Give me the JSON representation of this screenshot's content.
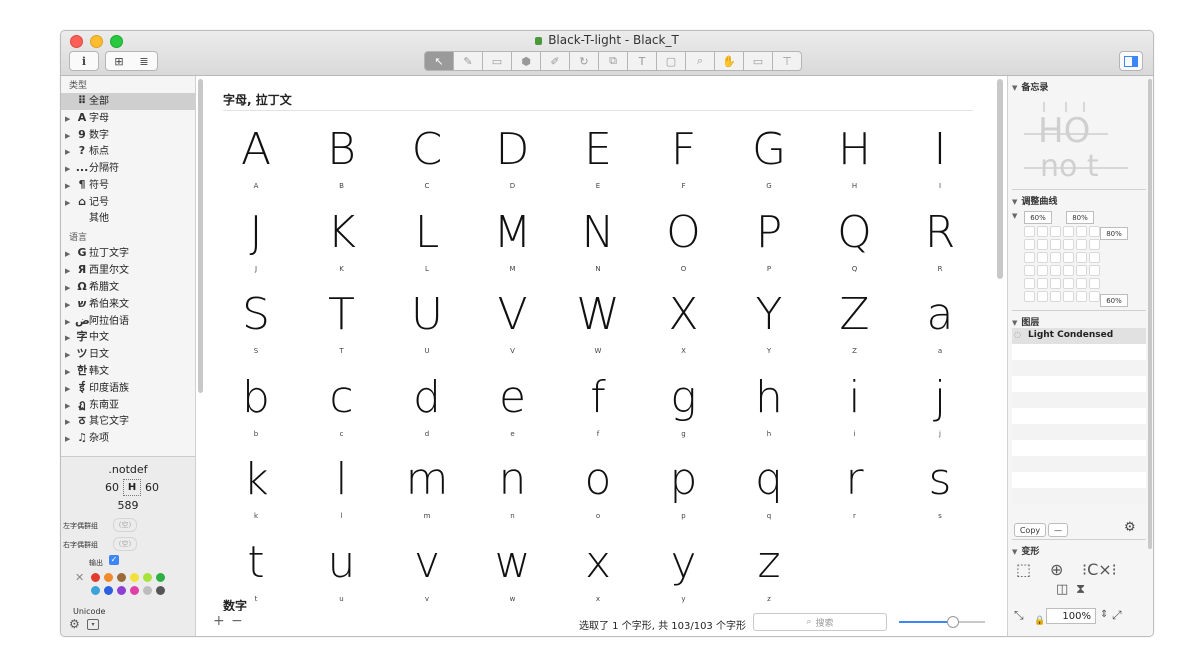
{
  "window": {
    "title": "Black-T-light - Black_T"
  },
  "toolbar": {
    "info_label": "i",
    "grid_view_label": "⊞",
    "list_view_label": "≣",
    "tools": [
      "↖",
      "✎",
      "▭",
      "⬢",
      "✐",
      "↻",
      "⧉",
      "T",
      "▢",
      "⌕",
      "✋",
      "▭",
      "⊤"
    ]
  },
  "sidebar": {
    "category_header": "类型",
    "categories": [
      {
        "glyph": "⠿",
        "label": "全部",
        "selected": true
      },
      {
        "glyph": "A",
        "label": "字母"
      },
      {
        "glyph": "9",
        "label": "数字"
      },
      {
        "glyph": "?",
        "label": "标点"
      },
      {
        "glyph": "...",
        "label": "分隔符"
      },
      {
        "glyph": "¶",
        "label": "符号"
      },
      {
        "glyph": "⌂",
        "label": "记号"
      },
      {
        "glyph": "",
        "label": "其他"
      }
    ],
    "language_header": "语言",
    "languages": [
      {
        "glyph": "G",
        "label": "拉丁文字"
      },
      {
        "glyph": "Я",
        "label": "西里尔文"
      },
      {
        "glyph": "Ω",
        "label": "希腊文"
      },
      {
        "glyph": "ש",
        "label": "希伯来文"
      },
      {
        "glyph": "ض",
        "label": "阿拉伯语"
      },
      {
        "glyph": "字",
        "label": "中文"
      },
      {
        "glyph": "ツ",
        "label": "日文"
      },
      {
        "glyph": "한",
        "label": "韩文"
      },
      {
        "glyph": "ई",
        "label": "印度语族"
      },
      {
        "glyph": "ฏ",
        "label": "东南亚"
      },
      {
        "glyph": "ठ",
        "label": "其它文字"
      },
      {
        "glyph": "♫",
        "label": "杂项"
      }
    ]
  },
  "info": {
    "glyph_name": ".notdef",
    "lsb": "60",
    "rsb": "60",
    "width": "589",
    "left_group_label": "左字偶群组",
    "right_group_label": "右字偶群组",
    "empty_placeholder": "(空)",
    "export_label": "输出",
    "unicode_label": "Unicode",
    "swatches": [
      "#e23b2f",
      "#f08a2c",
      "#9b6a3a",
      "#f3e03b",
      "#a7e33b",
      "#2fae43",
      "#3aa3d9",
      "#2d5fe0",
      "#8e3fd6",
      "#e03fa8",
      "#bdbdbd",
      "#555555"
    ]
  },
  "main": {
    "group_title": "字母, 拉丁文",
    "next_group_title": "数字",
    "glyphs": [
      "A",
      "B",
      "C",
      "D",
      "E",
      "F",
      "G",
      "H",
      "I",
      "J",
      "K",
      "L",
      "M",
      "N",
      "O",
      "P",
      "Q",
      "R",
      "S",
      "T",
      "U",
      "V",
      "W",
      "X",
      "Y",
      "Z",
      "a",
      "b",
      "c",
      "d",
      "e",
      "f",
      "g",
      "h",
      "i",
      "j",
      "k",
      "l",
      "m",
      "n",
      "o",
      "p",
      "q",
      "r",
      "s",
      "t",
      "u",
      "v",
      "w",
      "x",
      "y",
      "z"
    ]
  },
  "status": {
    "text": "选取了 1 个字形, 共 103/103 个字形",
    "search_placeholder": "搜索",
    "add_label": "+",
    "remove_label": "−",
    "zoom_slider": 0.62
  },
  "right_panel": {
    "notes_header": "备忘录",
    "preview_top": "HO",
    "preview_bottom": "no t",
    "curve_header": "调整曲线",
    "curve_values": [
      "60%",
      "80%",
      "80%",
      "60%"
    ],
    "layers_header": "图层",
    "layer_name": "Light Condensed",
    "copy_label": "Copy",
    "minus_label": "—",
    "transform_header": "变形",
    "zoom_value": "100%"
  }
}
